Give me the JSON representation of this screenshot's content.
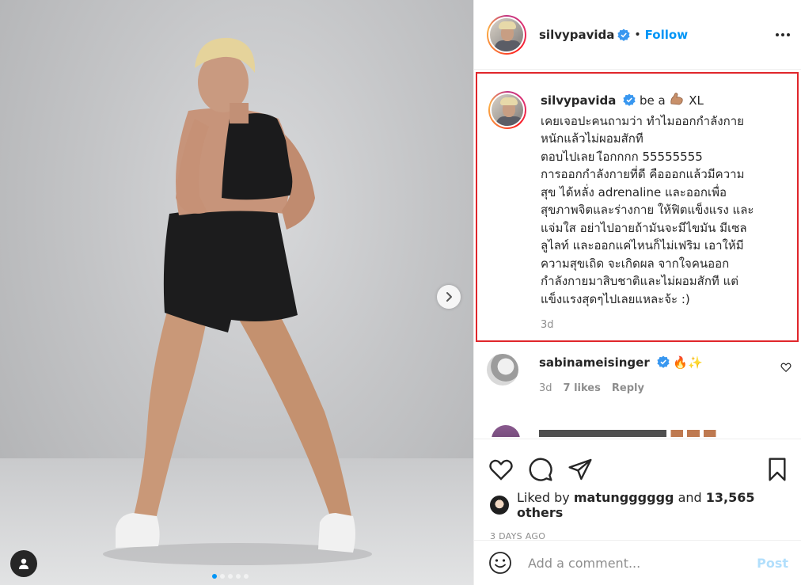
{
  "post": {
    "username": "silvypavida",
    "follow_label": "Follow",
    "bullet": "•",
    "carousel_dots": 5,
    "carousel_active_index": 0
  },
  "caption": {
    "username": "silvypavida",
    "lead": "be a",
    "lead_emoji": "flexed-biceps-icon",
    "lead_after": "XL",
    "lines": [
      "เคยเจอปะคนถามว่า ทำไมออกกำลังกาย",
      "หนักแล้วไม่ผอมสักที",
      "ตอบไปเลย เ",
      "ือกกกก 55555555",
      "การออกกำลังกายที่ดี คือออกแล้วมีความ",
      "สุข ได้หลั่ง adrenaline และออกเพื่อ",
      "สุขภาพจิตและร่างกาย ให้ฟิตแข็งแรง และ",
      "แจ่มใส อย่าไปอายถ้ามันจะมีไขมัน มีเซล",
      "ลูไลท์ และออกแค่ไหนก็ไม่เฟริม เอาให้มี",
      "ความสุขเถิด จะเกิดผล จากใจคนออก",
      "กำลังกายมาสิบชาติและไม่ผอมสักที แต่",
      "แข็งแรงสุดๆไปเลยแหละจ้ะ :)"
    ],
    "time": "3d"
  },
  "comment": {
    "username": "sabinameisinger",
    "text_emojis": "🔥✨",
    "time": "3d",
    "likes": "7 likes",
    "reply_label": "Reply"
  },
  "likes_bar": {
    "liked_by_prefix": "Liked by",
    "liker": "matungggggg",
    "and": "and",
    "others": "13,565 others",
    "date": "3 DAYS AGO"
  },
  "add_comment": {
    "placeholder": "Add a comment...",
    "post_label": "Post"
  },
  "colors": {
    "accent_blue": "#0095f6",
    "highlight_red": "#e0262b",
    "muted_text": "#8e8e8e"
  }
}
